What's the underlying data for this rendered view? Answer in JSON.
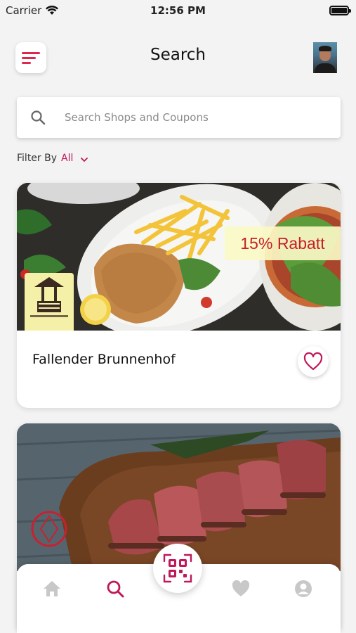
{
  "status_bar": {
    "carrier": "Carrier",
    "time": "12:56 PM"
  },
  "header": {
    "title": "Search"
  },
  "search": {
    "placeholder": "Search Shops and Coupons",
    "value": ""
  },
  "filter": {
    "label": "Filter By",
    "value": "All"
  },
  "cards": [
    {
      "title": "Fallender Brunnenhof",
      "badge": "15% Rabatt",
      "favorited": false
    },
    {
      "title": "",
      "badge": "",
      "favorited": false
    }
  ],
  "nav": {
    "items": [
      {
        "icon": "home-icon",
        "active": false
      },
      {
        "icon": "search-icon",
        "active": true
      },
      {
        "icon": "qr-code-icon",
        "active": false
      },
      {
        "icon": "heart-icon",
        "active": false
      },
      {
        "icon": "profile-icon",
        "active": false
      }
    ]
  },
  "colors": {
    "accent": "#c0185a",
    "menu_accent": "#e0264a",
    "inactive": "#c8c8c8",
    "badge_text": "#c91d2a"
  }
}
